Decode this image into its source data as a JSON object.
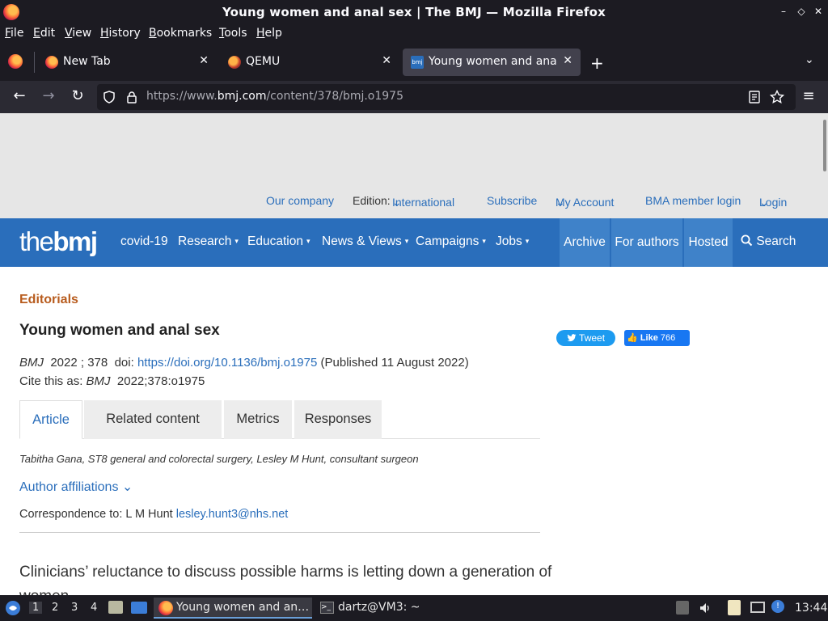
{
  "window": {
    "title": "Young women and anal sex | The BMJ — Mozilla Firefox",
    "controls": {
      "minimize": "–",
      "restore": "◇",
      "close": "✕"
    }
  },
  "menubar": [
    "File",
    "Edit",
    "View",
    "History",
    "Bookmarks",
    "Tools",
    "Help"
  ],
  "tabs": [
    {
      "label": "New Tab",
      "icon": "firefox-icon",
      "close": "✕"
    },
    {
      "label": "QEMU",
      "icon": "qemu-icon",
      "close": "✕"
    },
    {
      "label": "Young women and anal s",
      "icon": "bmj-icon",
      "close": "✕",
      "active": true
    }
  ],
  "navbar": {
    "back": "←",
    "forward": "→",
    "reload": "↻",
    "url_prefix": "https://www.",
    "url_domain": "bmj.com",
    "url_path": "/content/378/bmj.o1975",
    "menu": "≡"
  },
  "utility_nav": {
    "our_company": "Our company",
    "edition_label": "Edition:",
    "edition_value": "International",
    "subscribe": "Subscribe",
    "my_account": "My Account",
    "bma_login": "BMA member login",
    "login": "Login",
    "chevron": "⌄"
  },
  "bmj_nav": {
    "logo_the": "the",
    "logo_bmj": "bmj",
    "items": [
      "covid-19",
      "Research",
      "Education",
      "News & Views",
      "Campaigns",
      "Jobs"
    ],
    "chevron": "▾",
    "boxes": [
      "Archive",
      "For authors",
      "Hosted"
    ],
    "search": "Search"
  },
  "article": {
    "section": "Editorials",
    "title": "Young women and anal sex",
    "journal": "BMJ",
    "year_vol": "2022 ; 378",
    "doi_label": "doi:",
    "doi_link": "https://doi.org/10.1136/bmj.o1975",
    "published": "(Published 11 August 2022)",
    "cite_label": "Cite this as:",
    "cite_journal": "BMJ",
    "cite_ref": "2022;378:o1975",
    "tabs": [
      "Article",
      "Related content",
      "Metrics",
      "Responses"
    ],
    "authors": "Tabitha Gana, ST8 general and colorectal surgery,  Lesley M Hunt, consultant surgeon",
    "affiliations": "Author affiliations",
    "affil_chevron": "⌄",
    "corr_label": "Correspondence to: L M Hunt",
    "corr_email": "lesley.hunt3@nhs.net",
    "standfirst": "Clinicians’ reluctance to discuss possible harms is letting down a generation of women"
  },
  "social": {
    "tweet": "Tweet",
    "like": "Like",
    "like_count": "766"
  },
  "taskbar": {
    "workspaces": [
      "1",
      "2",
      "3",
      "4"
    ],
    "tasks": [
      {
        "label": "Young women and an…",
        "icon": "firefox-icon"
      },
      {
        "label": "dartz@VM3: ~",
        "icon": "terminal-icon"
      }
    ],
    "clock": "13:44"
  },
  "colors": {
    "bmj_blue": "#2a6ebb",
    "section_orange": "#b85c1e",
    "chrome_dark": "#1c1b22"
  }
}
